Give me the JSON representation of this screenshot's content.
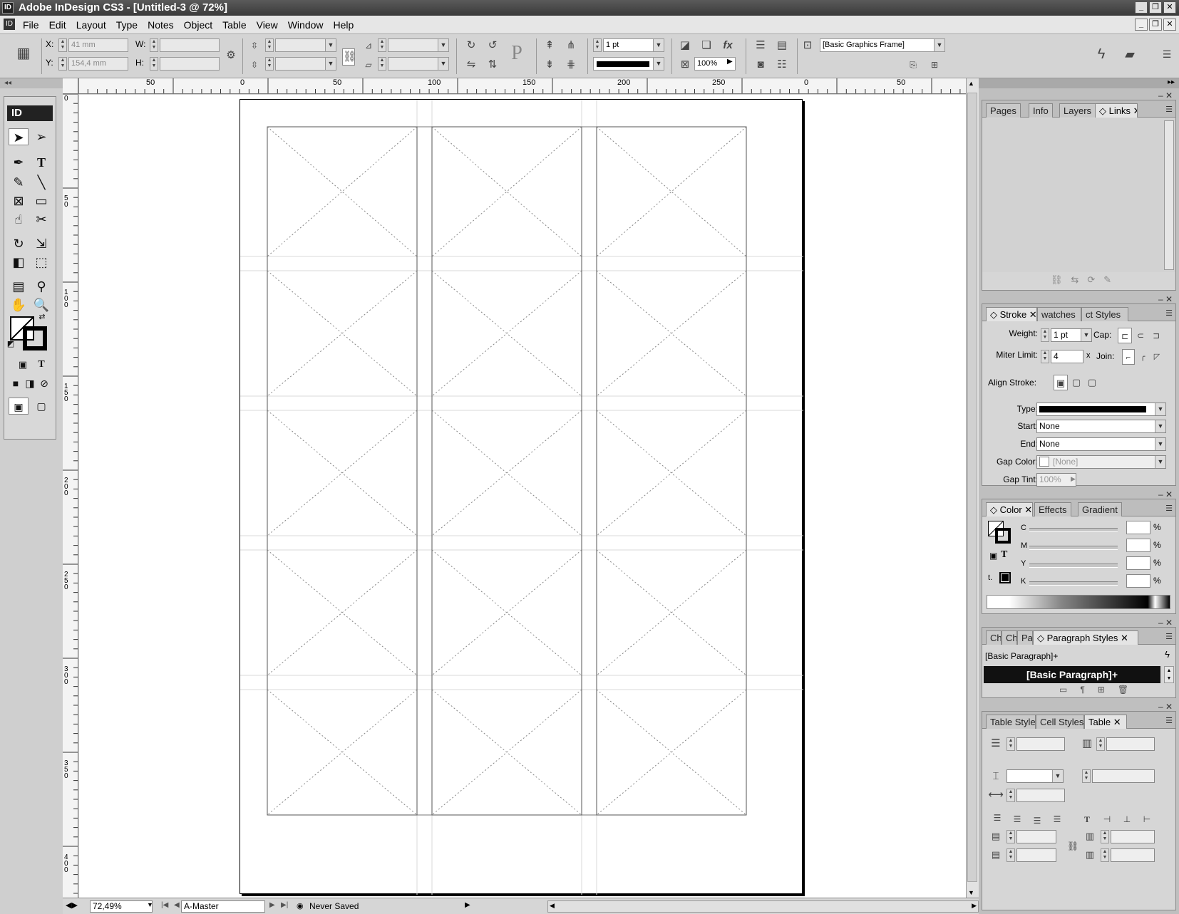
{
  "window": {
    "title": "Adobe InDesign CS3 - [Untitled-3 @ 72%]",
    "app_badge": "ID"
  },
  "menu": [
    "File",
    "Edit",
    "Layout",
    "Type",
    "Notes",
    "Object",
    "Table",
    "View",
    "Window",
    "Help"
  ],
  "control": {
    "x_label": "X:",
    "x_value": "41 mm",
    "y_label": "Y:",
    "y_value": "154,4 mm",
    "w_label": "W:",
    "h_label": "H:",
    "stroke_weight": "1 pt",
    "opacity": "100%",
    "object_style": "[Basic Graphics Frame]"
  },
  "toolbox": {
    "badge": "ID"
  },
  "rulers": {
    "h_ticks": [
      "50",
      "0",
      "50",
      "100",
      "150",
      "200",
      "250",
      "0",
      "50"
    ],
    "v_ticks": [
      "0",
      "50",
      "100",
      "150",
      "200",
      "250",
      "300",
      "350",
      "400"
    ]
  },
  "status": {
    "zoom": "72,49%",
    "master": "A-Master",
    "save_state": "Never Saved"
  },
  "panels": {
    "links": {
      "tabs": [
        "Pages",
        "Info",
        "Layers",
        "Links"
      ],
      "active": "Links"
    },
    "stroke": {
      "tabs": [
        "Stroke",
        "watches",
        "ct Styles"
      ],
      "weight_label": "Weight:",
      "weight": "1 pt",
      "cap_label": "Cap:",
      "miter_label": "Miter Limit:",
      "miter": "4",
      "miter_unit": "x",
      "join_label": "Join:",
      "align_label": "Align Stroke:",
      "type_label": "Type:",
      "start_label": "Start:",
      "start": "None",
      "end_label": "End:",
      "end": "None",
      "gapcolor_label": "Gap Color:",
      "gapcolor": "[None]",
      "gaptint_label": "Gap Tint:",
      "gaptint": "100%"
    },
    "color": {
      "tabs": [
        "Color",
        "Effects",
        "Gradient"
      ],
      "channels": [
        "C",
        "M",
        "Y",
        "K"
      ],
      "unit": "%"
    },
    "paragraph": {
      "tabs": [
        "Ch",
        "Ch",
        "Pa",
        "Paragraph Styles"
      ],
      "current": "[Basic Paragraph]+",
      "selected": "[Basic Paragraph]+"
    },
    "table": {
      "tabs": [
        "Table Style",
        "Cell Styles",
        "Table"
      ]
    }
  }
}
